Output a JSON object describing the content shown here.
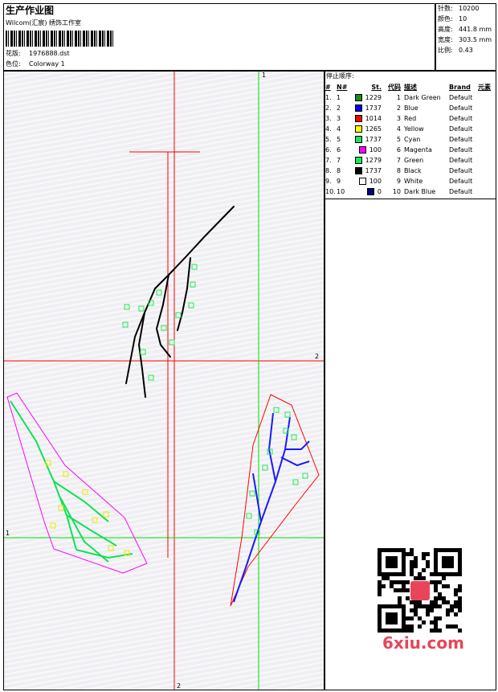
{
  "header": {
    "title": "生产作业图",
    "company": "Wilcom(汇宸) 绣饰工作室",
    "design_label": "花版:",
    "design_value": "1976888.dst",
    "colorway_label": "色位:",
    "colorway_value": "Colorway 1"
  },
  "stats": {
    "stitches_label": "针数:",
    "stitches_value": "10200",
    "colors_label": "颜色:",
    "colors_value": "10",
    "height_label": "高度:",
    "height_value": "441.8 mm",
    "width_label": "宽度:",
    "width_value": "303.5 mm",
    "ratio_label": "比例:",
    "ratio_value": "0.43"
  },
  "stop_sequence": {
    "title": "停止顺序:",
    "headers": [
      "#",
      "N#",
      "St.",
      "代码",
      "描述",
      "Brand",
      "元素"
    ],
    "rows": [
      {
        "idx": "1.",
        "n": "1",
        "st": "1229",
        "code": "1",
        "desc": "Dark Green",
        "brand": "Default",
        "color": "#1a8a1a"
      },
      {
        "idx": "2.",
        "n": "2",
        "st": "1737",
        "code": "2",
        "desc": "Blue",
        "brand": "Default",
        "color": "#0000ff"
      },
      {
        "idx": "3.",
        "n": "3",
        "st": "1014",
        "code": "3",
        "desc": "Red",
        "brand": "Default",
        "color": "#ff0000"
      },
      {
        "idx": "4.",
        "n": "4",
        "st": "1265",
        "code": "4",
        "desc": "Yellow",
        "brand": "Default",
        "color": "#ffff00"
      },
      {
        "idx": "5.",
        "n": "5",
        "st": "1737",
        "code": "5",
        "desc": "Cyan",
        "brand": "Default",
        "color": "#22dd66"
      },
      {
        "idx": "6.",
        "n": "6",
        "st": "100",
        "code": "6",
        "desc": "Magenta",
        "brand": "Default",
        "color": "#ff00ff"
      },
      {
        "idx": "7.",
        "n": "7",
        "st": "1279",
        "code": "7",
        "desc": "Green",
        "brand": "Default",
        "color": "#11ee55"
      },
      {
        "idx": "8.",
        "n": "8",
        "st": "1737",
        "code": "8",
        "desc": "Black",
        "brand": "Default",
        "color": "#000000"
      },
      {
        "idx": "9.",
        "n": "9",
        "st": "100",
        "code": "9",
        "desc": "White",
        "brand": "Default",
        "color": "#ffffff"
      },
      {
        "idx": "10.",
        "n": "10",
        "st": "0",
        "code": "10",
        "desc": "Dark Blue",
        "brand": "Default",
        "color": "#000080"
      }
    ]
  },
  "canvas": {
    "guide_labels": {
      "top_green": "1",
      "right_red": "2",
      "left_green": "1",
      "bottom_red": "2"
    }
  },
  "watermark": {
    "text": "6xiu.com"
  }
}
